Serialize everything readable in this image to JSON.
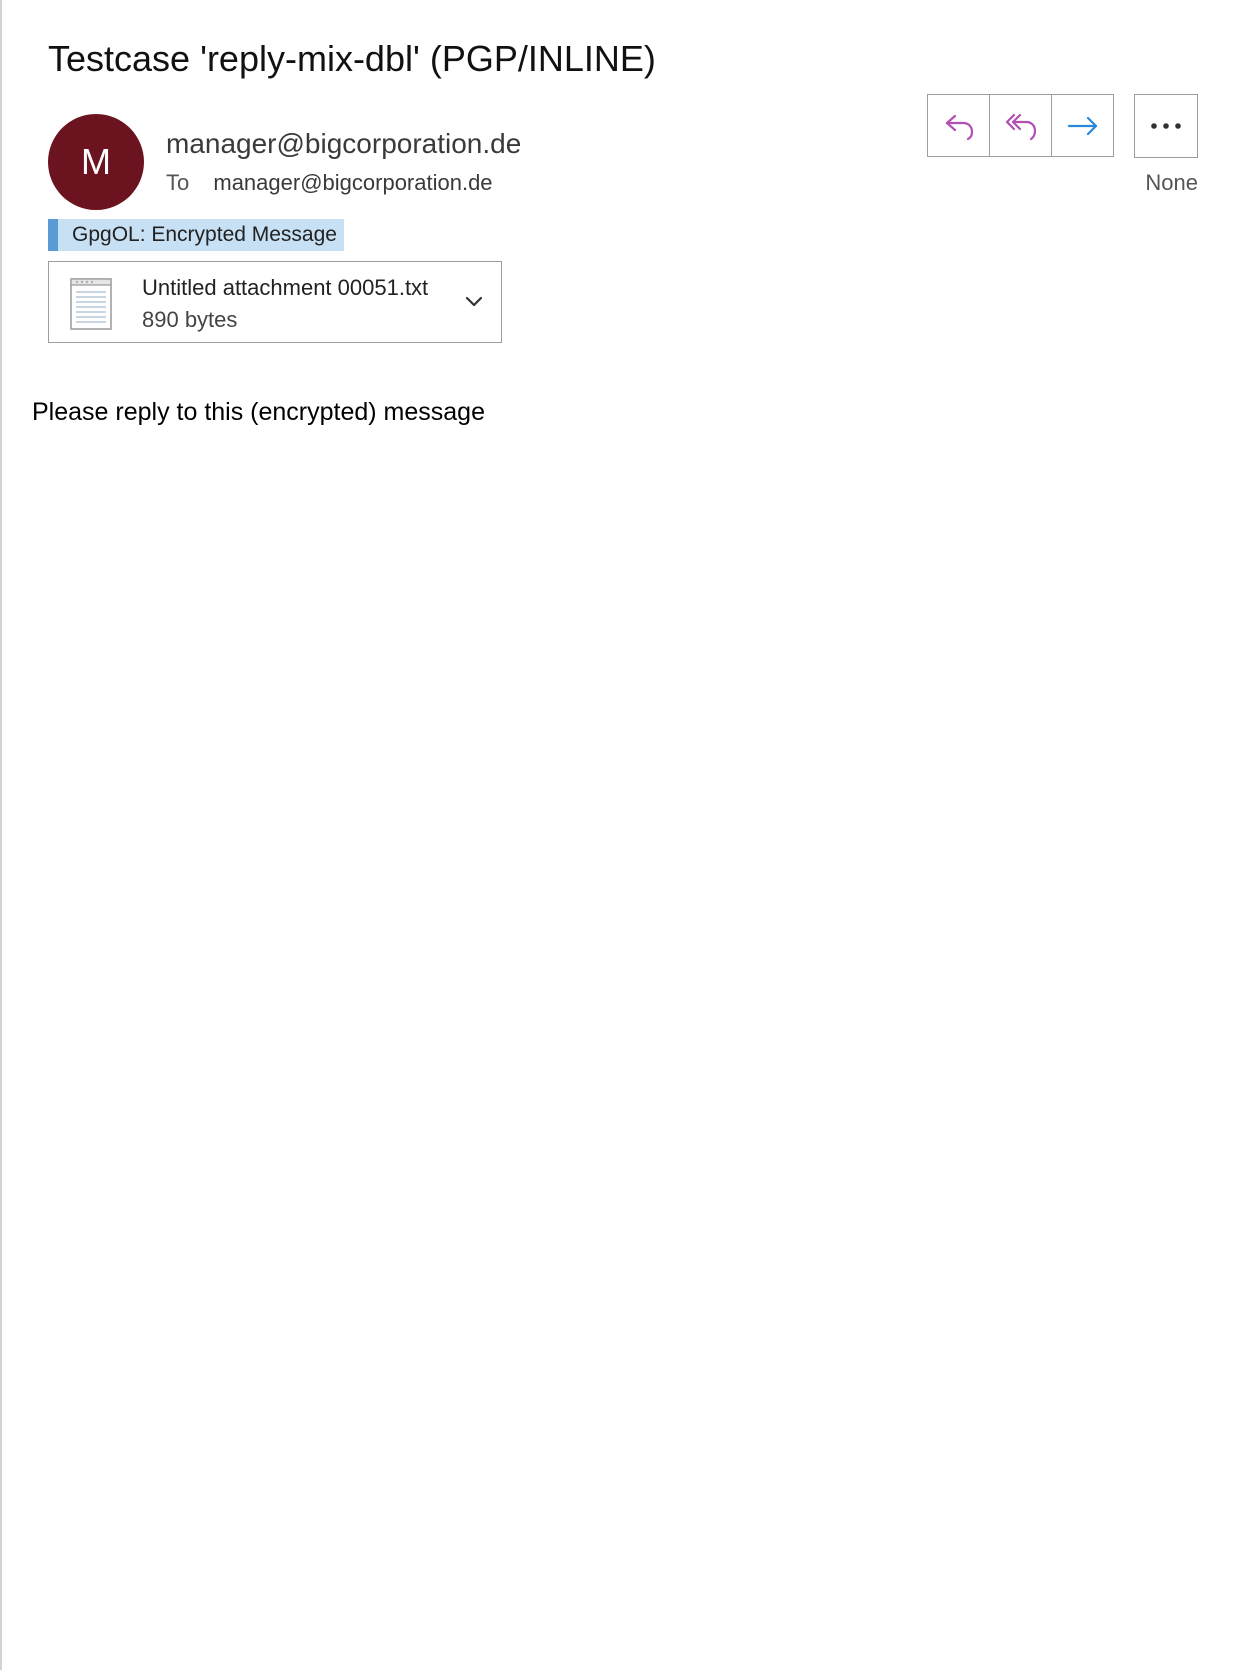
{
  "message": {
    "subject": "Testcase 'reply-mix-dbl' (PGP/INLINE)",
    "avatar_initial": "M",
    "sender": "manager@bigcorporation.de",
    "to_label": "To",
    "to_address": "manager@bigcorporation.de",
    "importance": "None",
    "body": "Please reply to this (encrypted) message"
  },
  "gpgol": {
    "banner": "GpgOL: Encrypted Message"
  },
  "attachment": {
    "name": "Untitled attachment 00051.txt",
    "size": "890 bytes",
    "icon": "text-file-icon"
  },
  "actions": [
    {
      "name": "reply",
      "icon": "reply-arrow-icon"
    },
    {
      "name": "reply-all",
      "icon": "reply-all-arrow-icon"
    },
    {
      "name": "forward",
      "icon": "forward-arrow-icon"
    },
    {
      "name": "more",
      "icon": "ellipsis-icon"
    }
  ],
  "colors": {
    "avatar": "#6c1320",
    "reply_icons": "#b24fb3",
    "forward_icon": "#2b88d8",
    "banner_bg": "#c7e0f4",
    "banner_accent": "#5b9bd5"
  }
}
